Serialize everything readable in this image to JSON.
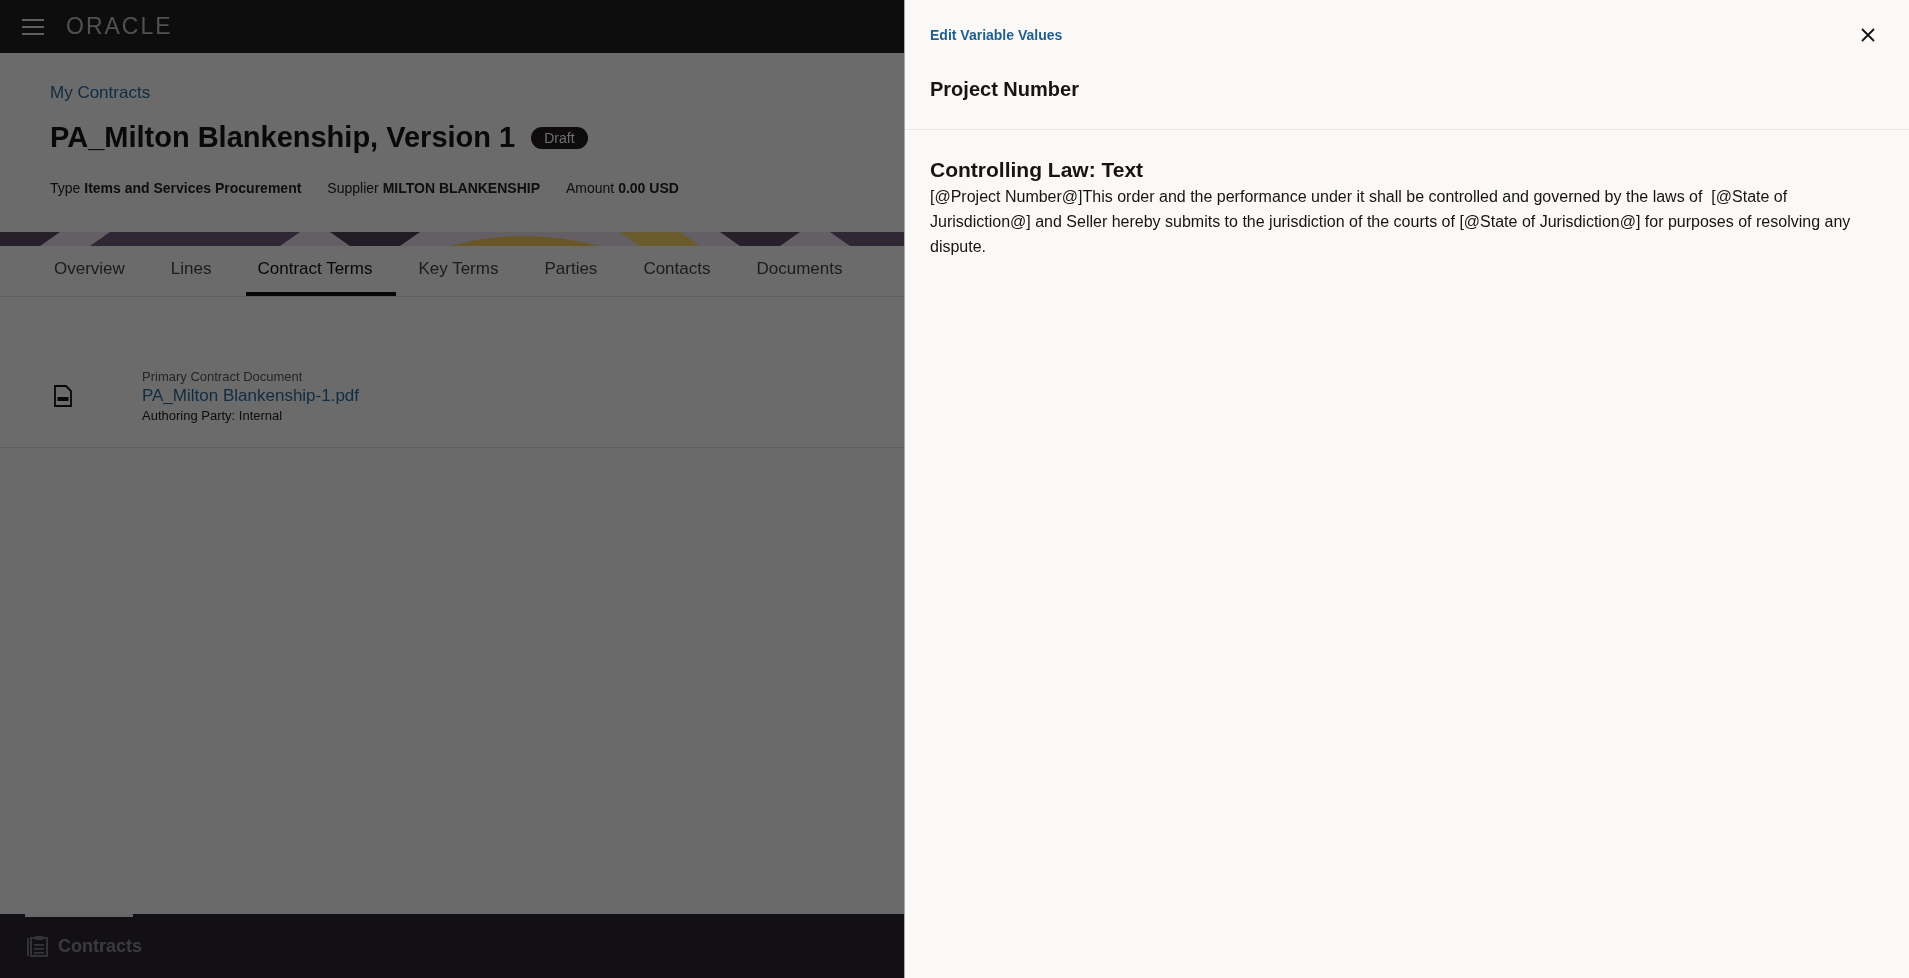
{
  "header": {
    "logo": "ORACLE"
  },
  "page": {
    "breadcrumb": "My Contracts",
    "title": "PA_Milton Blankenship, Version 1",
    "status_badge": "Draft",
    "meta": [
      {
        "label": "Type",
        "value": "Items and Services Procurement"
      },
      {
        "label": "Supplier",
        "value": "MILTON BLANKENSHIP"
      },
      {
        "label": "Amount",
        "value": "0.00 USD"
      }
    ],
    "tabs": [
      {
        "label": "Overview",
        "selected": false
      },
      {
        "label": "Lines",
        "selected": false
      },
      {
        "label": "Contract Terms",
        "selected": true
      },
      {
        "label": "Key Terms",
        "selected": false
      },
      {
        "label": "Parties",
        "selected": false
      },
      {
        "label": "Contacts",
        "selected": false
      },
      {
        "label": "Documents",
        "selected": false
      }
    ],
    "document": {
      "caption": "Primary Contract Document",
      "file": "PA_Milton Blankenship-1.pdf",
      "authoring_party": "Authoring Party: Internal"
    }
  },
  "bottom_bar": {
    "item": "Contracts"
  },
  "drawer": {
    "link": "Edit Variable Values",
    "title": "Project Number",
    "section_title": "Controlling Law: Text",
    "text": "[@Project Number@]This order and the performance under it shall be controlled and governed by the laws of  [@State of Jurisdiction@] and Seller hereby submits to the jurisdiction of the courts of [@State of Jurisdiction@] for purposes of resolving any dispute."
  }
}
